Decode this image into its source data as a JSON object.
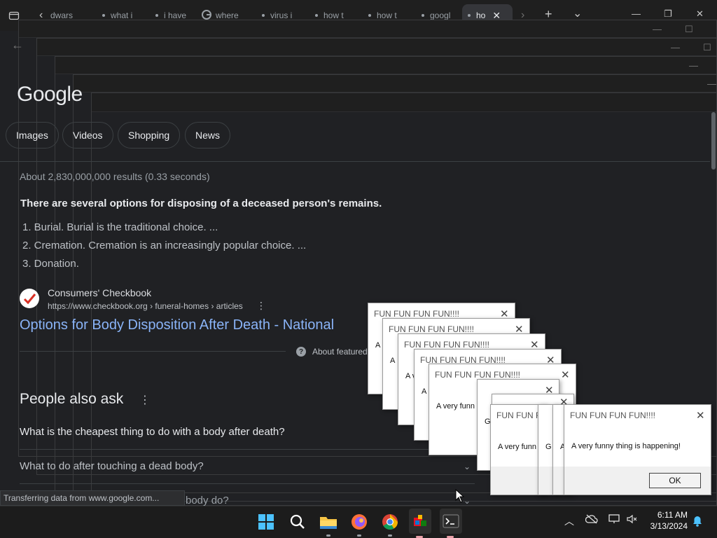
{
  "browser": {
    "tabs": [
      {
        "label": "dwars"
      },
      {
        "label": "what i"
      },
      {
        "label": "i have"
      },
      {
        "label": "where"
      },
      {
        "label": "virus i"
      },
      {
        "label": "how t"
      },
      {
        "label": "how t"
      },
      {
        "label": "googl"
      },
      {
        "label": "ho"
      }
    ]
  },
  "search": {
    "logo": "Google",
    "filters": [
      "Images",
      "Videos",
      "Shopping",
      "News"
    ],
    "result_stats": "About 2,830,000,000 results (0.33 seconds)",
    "featured_title": "There are several options for disposing of a deceased person's remains.",
    "featured_list": [
      "1. Burial. Burial is the traditional choice. ...",
      "2. Cremation. Cremation is an increasingly popular choice. ...",
      "3. Donation."
    ],
    "source_name": "Consumers' Checkbook",
    "source_url": "https://www.checkbook.org › funeral-homes › articles",
    "result_link": "Options for Body Disposition After Death - National",
    "about_featured": "About featured",
    "paa_title": "People also ask",
    "paa_questions": [
      "What is the cheapest thing to do with a body after death?",
      "What to do after touching a dead body?",
      "body do?"
    ]
  },
  "status_text": "Transferring data from www.google.com...",
  "popups": {
    "title": "FUN FUN FUN FUN!!!!",
    "title_truncated": "FUN FUN F",
    "message": "A very funny thing is happening!",
    "message_truncated": "A very funn",
    "fragment_a": "A",
    "fragment_av": "A v",
    "fragment_g": "G",
    "ok_label": "OK"
  },
  "taskbar": {
    "time": "6:11 AM",
    "date": "3/13/2024"
  },
  "colors": {
    "page_bg": "#202124",
    "link": "#8ab4f8",
    "taskbar_bg": "#1c1c1c"
  }
}
